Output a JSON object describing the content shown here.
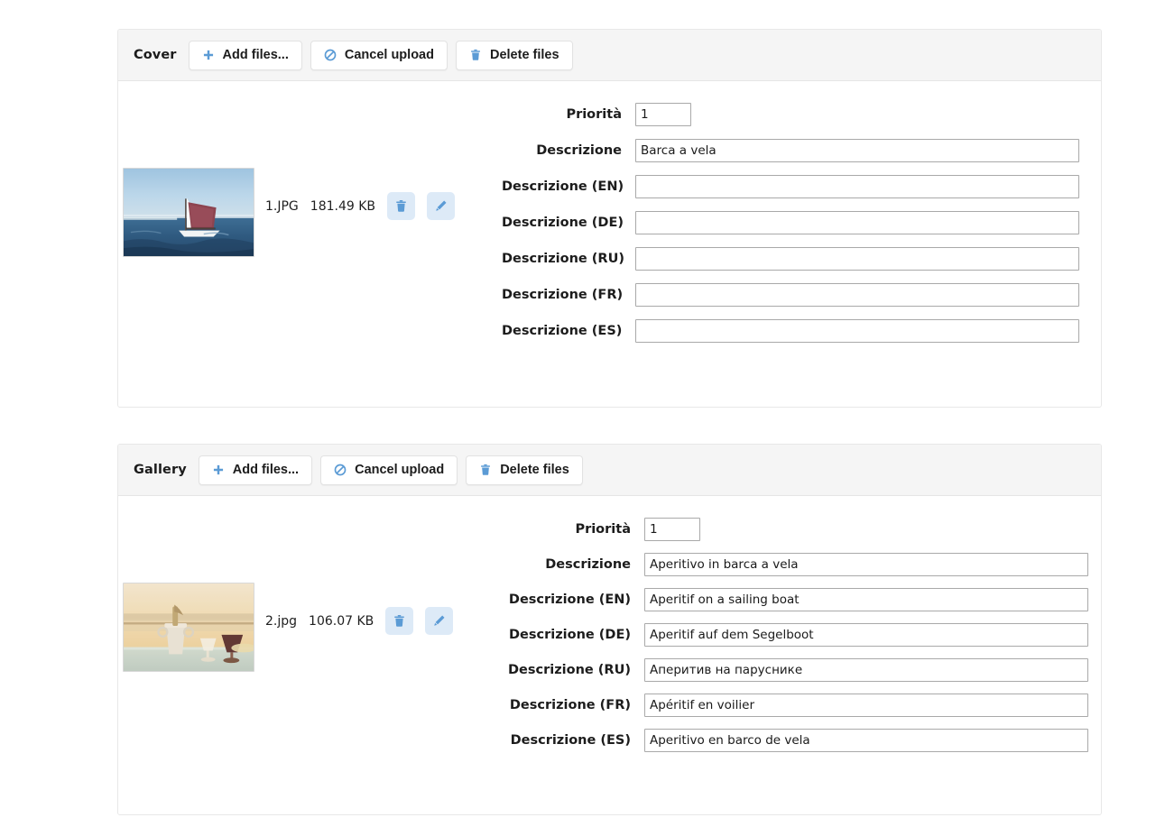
{
  "sections": [
    {
      "id": "cover",
      "label": "Cover",
      "toolbar": {
        "add_files": "Add files...",
        "cancel_upload": "Cancel upload",
        "delete_files": "Delete files",
        "add_icon": "plus-icon",
        "cancel_icon": "ban-circle-icon",
        "delete_icon": "trash-icon"
      },
      "file": {
        "name": "1.JPG",
        "size": "181.49 KB",
        "thumbnail_alt": "sailing-boat-on-sea",
        "delete_icon": "trash-icon",
        "edit_icon": "pencil-icon"
      },
      "fields": [
        {
          "label": "Priorità",
          "value": "1",
          "type": "number"
        },
        {
          "label": "Descrizione",
          "value": "Barca a vela",
          "type": "text"
        },
        {
          "label": "Descrizione (EN)",
          "value": "",
          "type": "text"
        },
        {
          "label": "Descrizione (DE)",
          "value": "",
          "type": "text"
        },
        {
          "label": "Descrizione (RU)",
          "value": "",
          "type": "text"
        },
        {
          "label": "Descrizione (FR)",
          "value": "",
          "type": "text"
        },
        {
          "label": "Descrizione (ES)",
          "value": "",
          "type": "text"
        }
      ]
    },
    {
      "id": "gallery",
      "label": "Gallery",
      "toolbar": {
        "add_files": "Add files...",
        "cancel_upload": "Cancel upload",
        "delete_files": "Delete files",
        "add_icon": "plus-icon",
        "cancel_icon": "ban-circle-icon",
        "delete_icon": "trash-icon"
      },
      "file": {
        "name": "2.jpg",
        "size": "106.07 KB",
        "thumbnail_alt": "aperitif-on-sailing-boat-at-sunset",
        "delete_icon": "trash-icon",
        "edit_icon": "pencil-icon"
      },
      "fields": [
        {
          "label": "Priorità",
          "value": "1",
          "type": "number"
        },
        {
          "label": "Descrizione",
          "value": "Aperitivo in barca a vela",
          "type": "text"
        },
        {
          "label": "Descrizione (EN)",
          "value": "Aperitif on a sailing boat",
          "type": "text"
        },
        {
          "label": "Descrizione (DE)",
          "value": "Aperitif auf dem Segelboot",
          "type": "text"
        },
        {
          "label": "Descrizione (RU)",
          "value": "Аперитив на паруснике",
          "type": "text"
        },
        {
          "label": "Descrizione (FR)",
          "value": "Apéritif en voilier",
          "type": "text"
        },
        {
          "label": "Descrizione (ES)",
          "value": "Aperitivo en barco de vela",
          "type": "text"
        }
      ]
    }
  ],
  "colors": {
    "accent": "#5b9bd5",
    "toolbar_bg": "#f5f5f5",
    "panel_border": "#e8e8e8",
    "action_btn_bg": "#ddeaf7",
    "input_border": "#a9a9a9"
  }
}
